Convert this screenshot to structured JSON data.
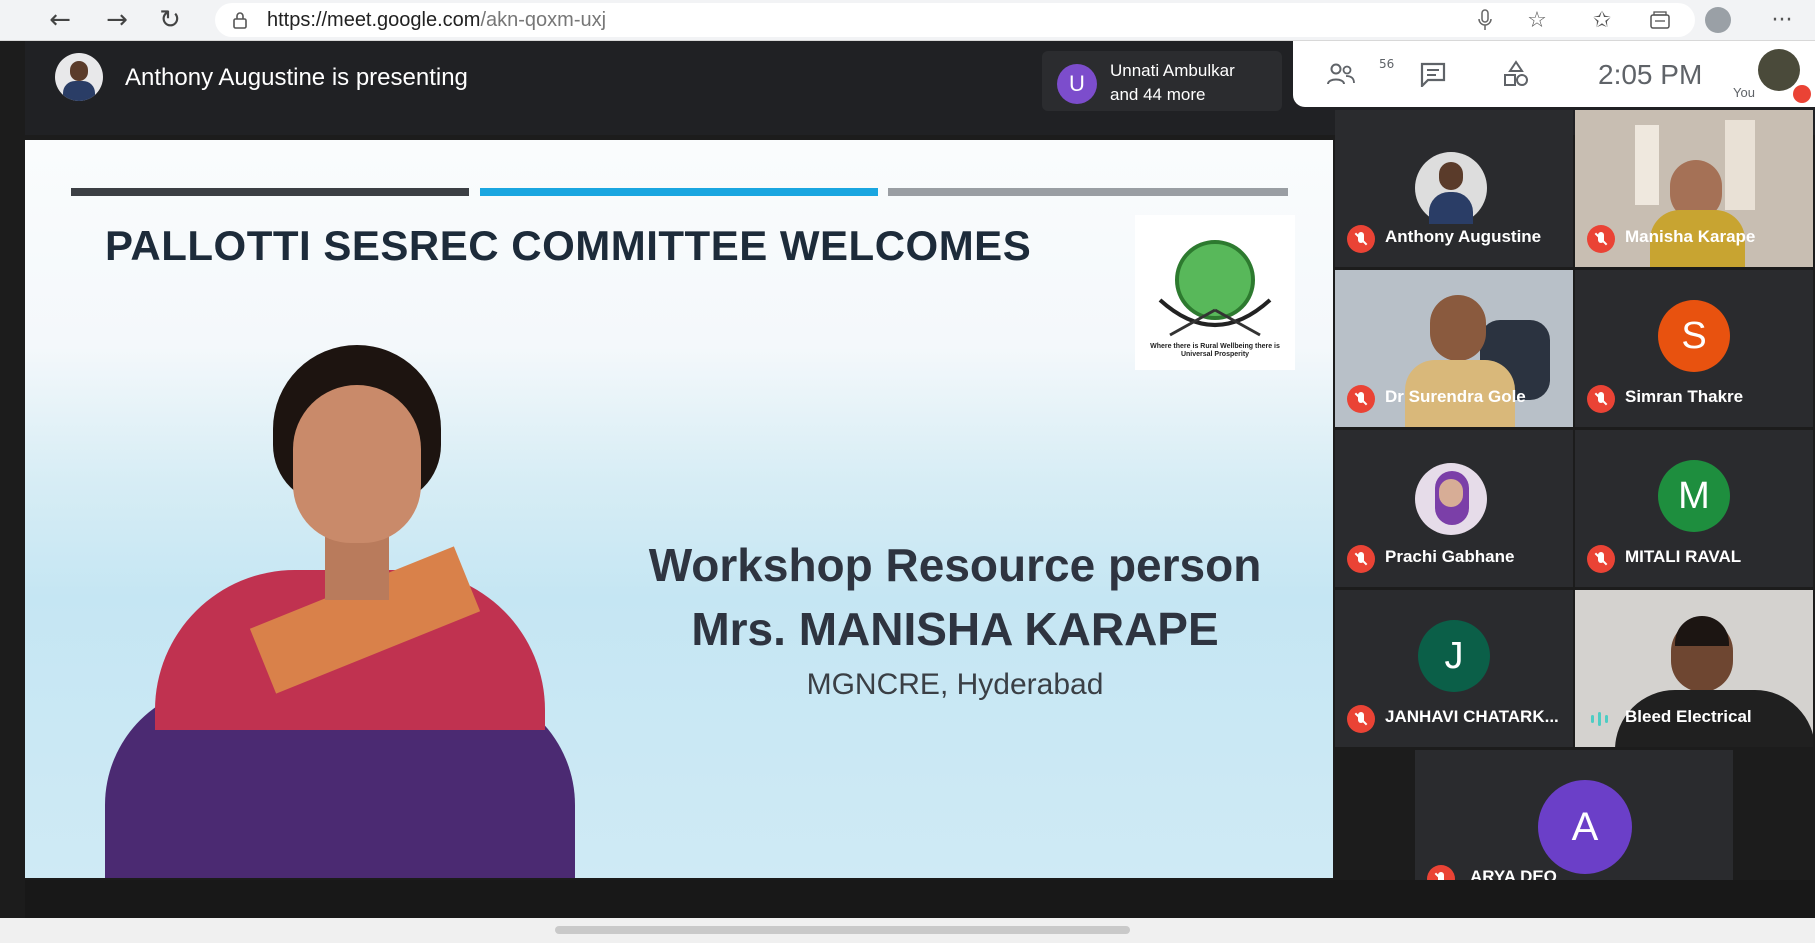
{
  "browser": {
    "url_domain": "https://meet.google.com",
    "url_path": "/akn-qoxm-uxj",
    "back_icon": "←",
    "forward_icon": "→",
    "refresh_icon": "↻",
    "more_icon": "···"
  },
  "meet": {
    "presenter_text": "Anthony Augustine is presenting",
    "chip_avatar_letter": "U",
    "chip_line1": "Unnati Ambulkar",
    "chip_line2": "and 44 more",
    "participant_count": "56",
    "time": "2:05 PM",
    "you_label": "You"
  },
  "slide": {
    "title": "PALLOTTI SESREC COMMITTEE WELCOMES",
    "logo_caption": "Where there is Rural Wellbeing there is Universal Prosperity",
    "line1": "Workshop Resource person",
    "line2": "Mrs. MANISHA KARAPE",
    "line3": "MGNCRE, Hyderabad",
    "bar_colors": [
      "#3c3f44",
      "#1aa6e0",
      "#9a9ea3"
    ]
  },
  "participants": [
    {
      "name": "Anthony Augustine",
      "type": "photo",
      "muted": true
    },
    {
      "name": "Manisha Karape",
      "type": "video",
      "muted": true
    },
    {
      "name": "Dr Surendra Gole",
      "type": "video",
      "muted": true
    },
    {
      "name": "Simran Thakre",
      "type": "letter",
      "letter": "S",
      "color": "#e8520f",
      "muted": true
    },
    {
      "name": "Prachi Gabhane",
      "type": "photo",
      "muted": true
    },
    {
      "name": "MITALI RAVAL",
      "type": "letter",
      "letter": "M",
      "color": "#1e8e3e",
      "muted": true
    },
    {
      "name": "JANHAVI CHATARK...",
      "type": "letter",
      "letter": "J",
      "color": "#0b5f48",
      "muted": true
    },
    {
      "name": "Bleed Electrical",
      "type": "video",
      "muted": false
    },
    {
      "name": "ARYA DEO",
      "type": "letter",
      "letter": "A",
      "color": "#6b3fc8",
      "muted": true
    }
  ]
}
